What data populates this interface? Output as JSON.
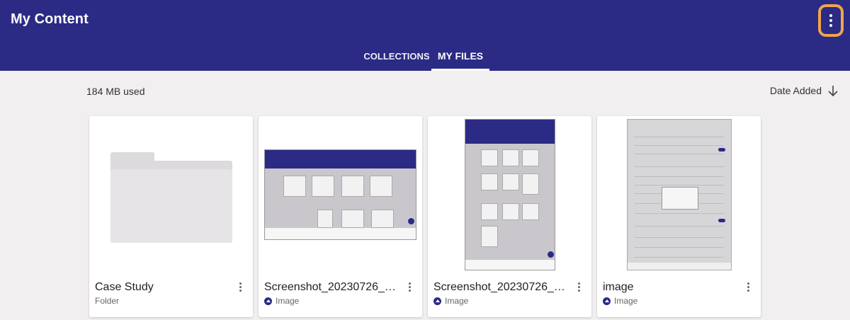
{
  "header": {
    "title": "My Content",
    "overflow_icon": "more-vertical-icon",
    "highlight_color": "#f0a548",
    "bar_color": "#2b2a85"
  },
  "tabs": [
    {
      "label": "COLLECTIONS",
      "selected": false
    },
    {
      "label": "MY FILES",
      "selected": true
    }
  ],
  "toolbar": {
    "storage_used": "184 MB used",
    "sort_label": "Date Added",
    "sort_icon": "arrow-down-icon"
  },
  "files": [
    {
      "name": "Case Study",
      "type": "Folder",
      "thumbnail": "folder-icon"
    },
    {
      "name": "Screenshot_20230726_1...",
      "type": "Image",
      "thumbnail": "screenshot-landscape"
    },
    {
      "name": "Screenshot_20230726_1...",
      "type": "Image",
      "thumbnail": "screenshot-portrait"
    },
    {
      "name": "image",
      "type": "Image",
      "thumbnail": "settings-screenshot"
    }
  ]
}
